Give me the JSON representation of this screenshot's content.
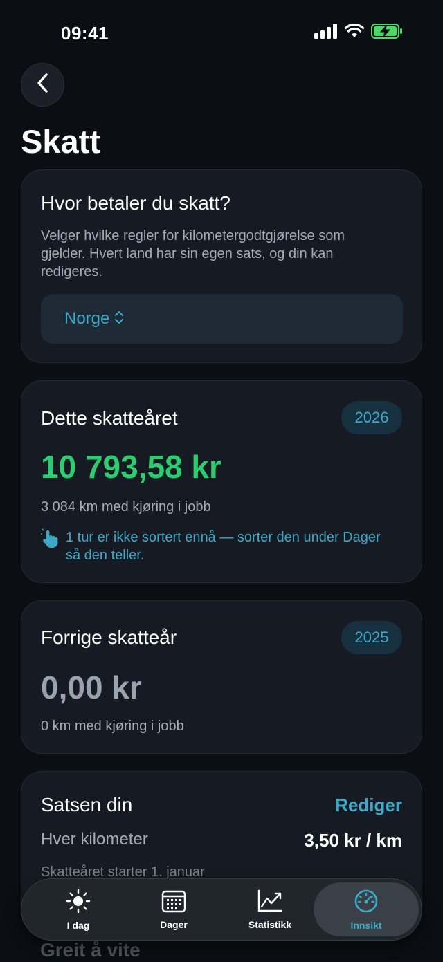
{
  "status_bar": {
    "time": "09:41"
  },
  "page": {
    "title": "Skatt"
  },
  "tax_country": {
    "title": "Hvor betaler du skatt?",
    "description": "Velger hvilke regler for kilometergodtgjørelse som gjelder. Hvert land har sin egen sats, og din kan redigeres.",
    "selected_country": "Norge"
  },
  "current_tax_year": {
    "title": "Dette skatteåret",
    "year": "2026",
    "amount": "10 793,58 kr",
    "km_text": "3 084 km med kjøring i jobb",
    "hint": "1 tur er ikke sortert ennå — sorter den under Dager så den teller."
  },
  "previous_tax_year": {
    "title": "Forrige skatteår",
    "year": "2025",
    "amount": "0,00 kr",
    "km_text": "0 km med kjøring i jobb"
  },
  "rate": {
    "title": "Satsen din",
    "edit_label": "Rediger",
    "per_km_label": "Hver kilometer",
    "per_km_value": "3,50 kr / km",
    "year_start_text": "Skatteåret starter 1. januar"
  },
  "good_to_know": {
    "title": "Greit å vite"
  },
  "tab_bar": {
    "tabs": [
      {
        "label": "I dag",
        "icon": "sun-icon"
      },
      {
        "label": "Dager",
        "icon": "calendar-icon"
      },
      {
        "label": "Statistikk",
        "icon": "chart-line-icon"
      },
      {
        "label": "Innsikt",
        "icon": "speedometer-icon"
      }
    ],
    "active_tab": "Innsikt"
  },
  "colors": {
    "background": "#0b0e12",
    "card": "#161b23",
    "accent": "#3ea9c7",
    "positive": "#2ecc71",
    "muted": "#9aa3ad"
  }
}
